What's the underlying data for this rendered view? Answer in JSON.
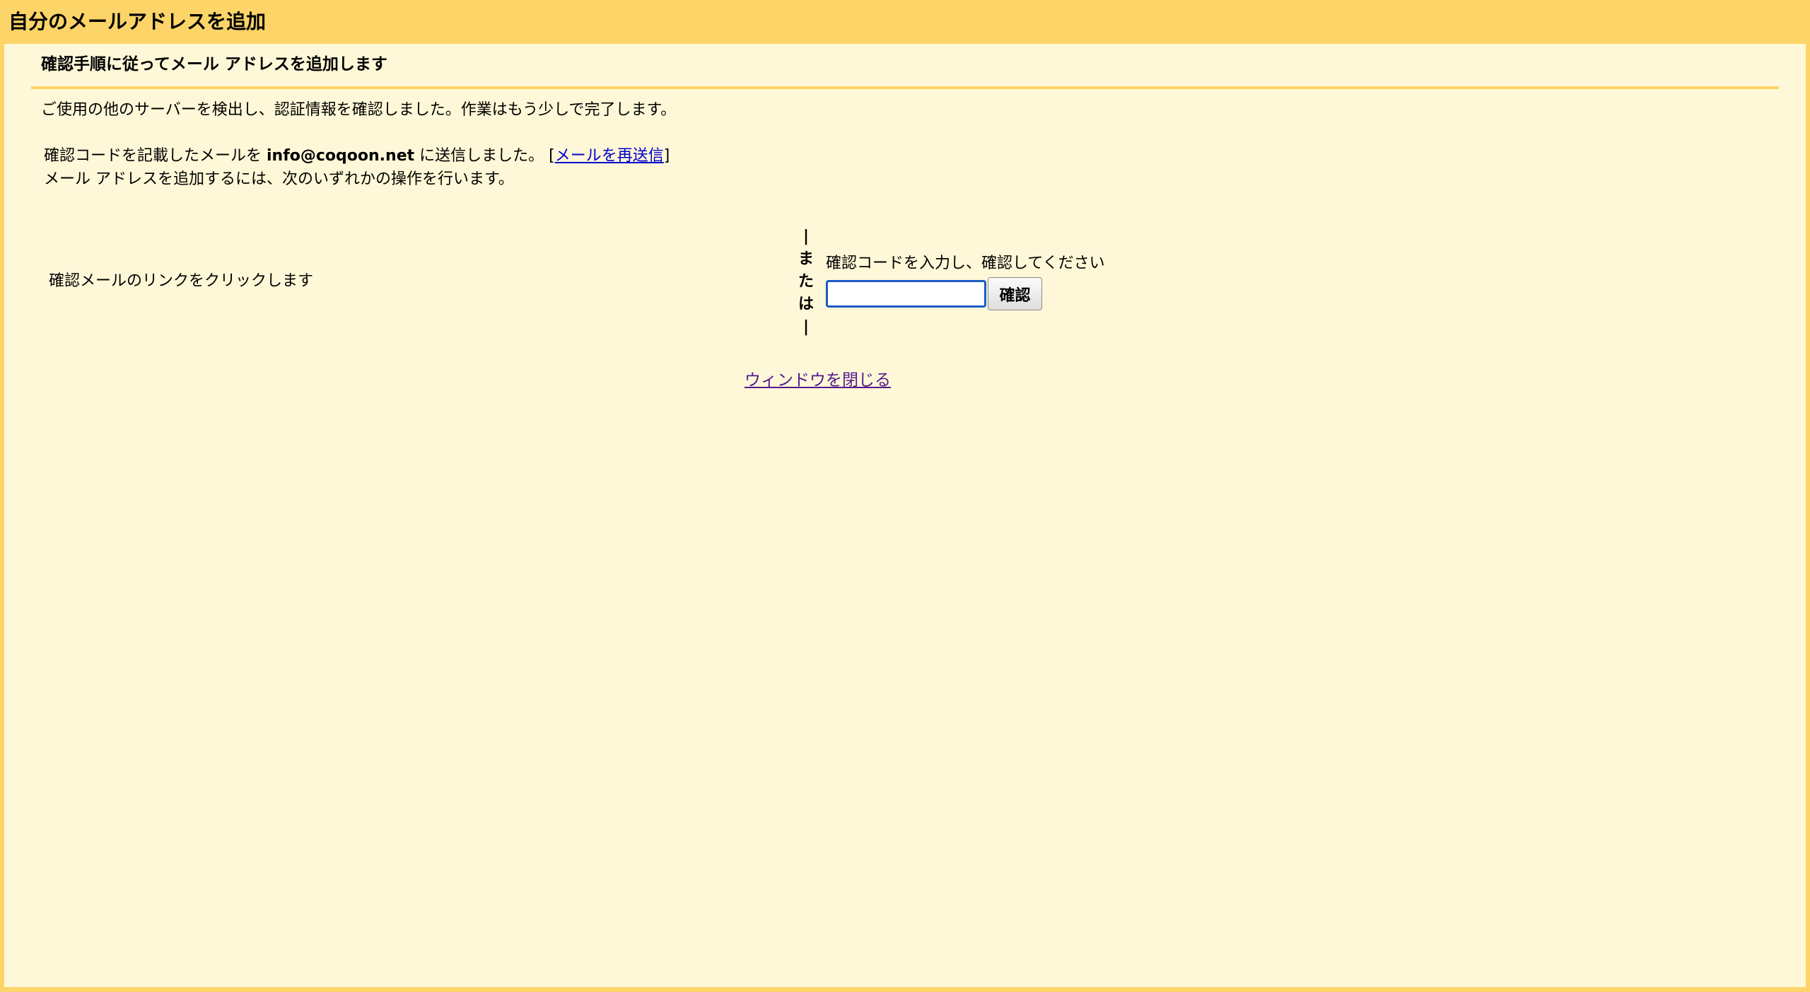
{
  "window": {
    "title": "自分のメールアドレスを追加"
  },
  "dialog": {
    "heading": "確認手順に従ってメール アドレスを追加します",
    "intro": "ご使用の他のサーバーを検出し、認証情報を確認しました。作業はもう少しで完了します。",
    "sent_prefix": "確認コードを記載したメールを ",
    "email": "info@coqoon.net",
    "sent_suffix": " に送信しました。 [",
    "resend_label": "メールを再送信",
    "bracket_close": "]",
    "instruction": "メール アドレスを追加するには、次のいずれかの操作を行います。",
    "left_option": "確認メールのリンクをクリックします",
    "or_lines": [
      "|",
      "ま",
      "た",
      "は",
      "|"
    ],
    "right_label": "確認コードを入力し、確認してください",
    "code_input": {
      "value": "",
      "placeholder": ""
    },
    "confirm_label": "確認",
    "close_label": "ウィンドウを閉じる"
  },
  "colors": {
    "frame": "#fcd468",
    "panel": "#fff8d8",
    "link": "#0000cc",
    "visited_link": "#551a8b",
    "input_border": "#1a5cc8"
  }
}
